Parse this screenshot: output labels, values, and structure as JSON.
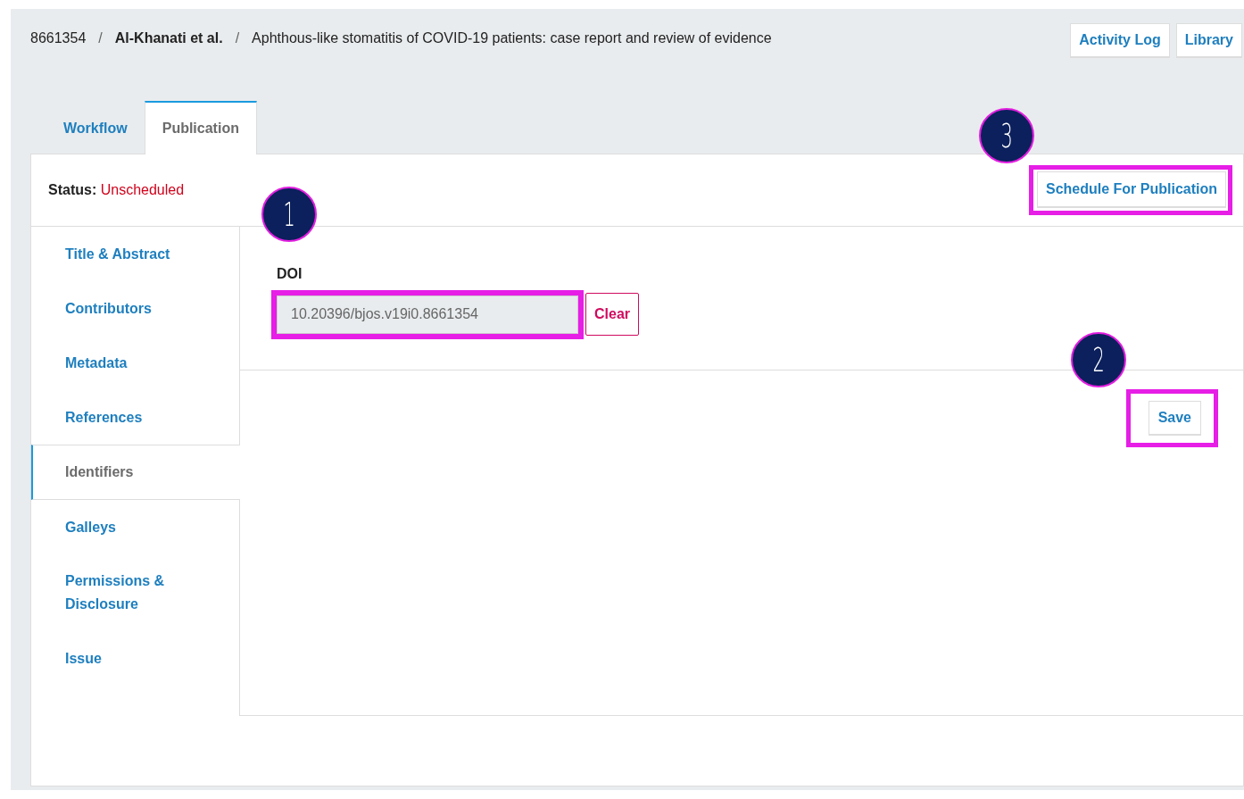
{
  "breadcrumb": [
    {
      "text": "8661354",
      "kind": "id"
    },
    {
      "text": "/",
      "kind": "separator"
    },
    {
      "text": "Al-Khanati et al.",
      "kind": "authors"
    },
    {
      "text": "/",
      "kind": "separator"
    },
    {
      "text": "Aphthous-like stomatitis of COVID-19 patients: case report and review of evidence",
      "kind": "title"
    }
  ],
  "header_buttons": [
    "Activity Log",
    "Library"
  ],
  "tabs": [
    {
      "label": "Workflow",
      "selected": false
    },
    {
      "label": "Publication",
      "selected": true
    }
  ],
  "status": {
    "label": "Status:",
    "value": "Unscheduled"
  },
  "schedule_button": {
    "label": "Schedule For Publication",
    "highlighted": true,
    "callout": "3"
  },
  "sidebar": {
    "items": [
      {
        "label": "Title & Abstract",
        "selected": false
      },
      {
        "label": "Contributors",
        "selected": false
      },
      {
        "label": "Metadata",
        "selected": false
      },
      {
        "label": "References",
        "selected": false
      },
      {
        "label": "Identifiers",
        "selected": true
      },
      {
        "label": "Galleys",
        "selected": false
      },
      {
        "label": "Permissions & Disclosure",
        "selected": false
      },
      {
        "label": "Issue",
        "selected": false
      }
    ]
  },
  "form": {
    "doi_label": "DOI",
    "doi_value": "10.20396/bjos.v19i0.8661354",
    "doi_highlighted": true,
    "doi_callout": "1",
    "clear_button": "Clear"
  },
  "save_button": {
    "label": "Save",
    "highlighted": true,
    "callout": "2"
  }
}
